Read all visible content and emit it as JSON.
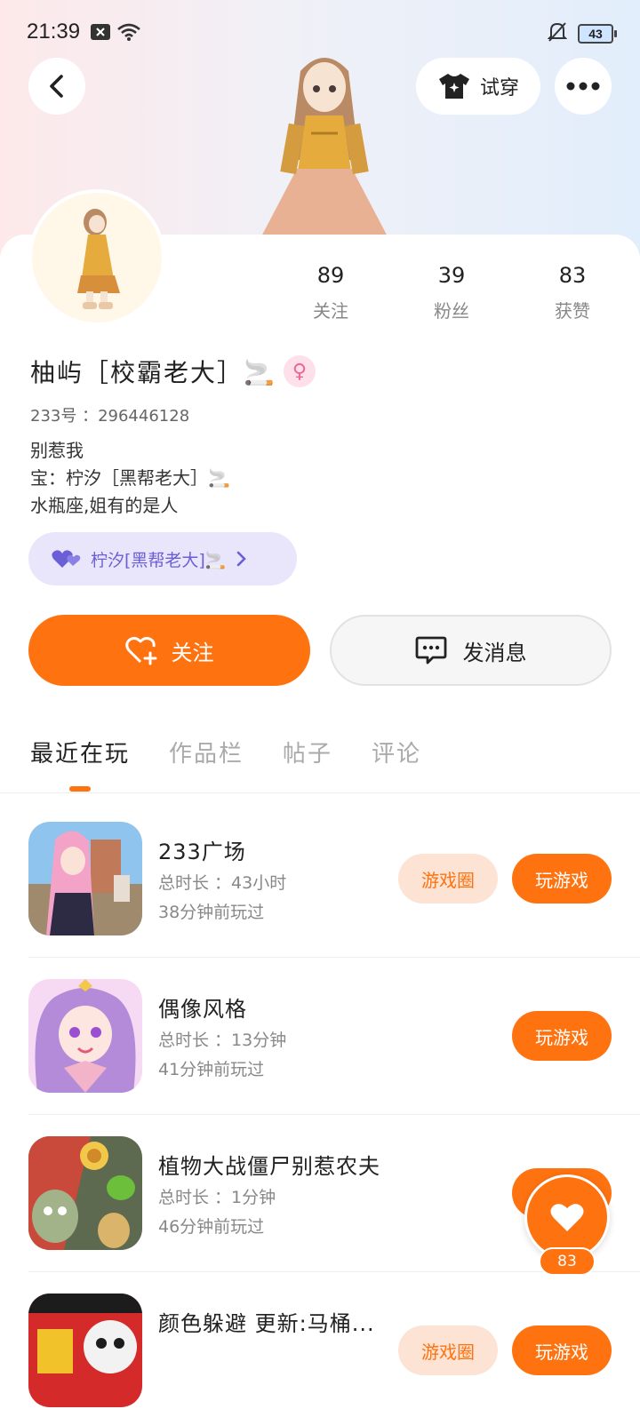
{
  "status_bar": {
    "time": "21:39",
    "battery": "43"
  },
  "header": {
    "try_on_label": "试穿"
  },
  "profile": {
    "stats": [
      {
        "num": "89",
        "label": "关注"
      },
      {
        "num": "39",
        "label": "粉丝"
      },
      {
        "num": "83",
        "label": "获赞"
      }
    ],
    "name": "柚屿［校霸老大］🚬",
    "uid": "233号 ：296446128",
    "bio_lines": [
      "别惹我",
      "宝：柠汐［黑帮老大］🚬",
      "水瓶座,姐有的是人"
    ],
    "relation_label": "柠汐[黑帮老大]🚬"
  },
  "actions": {
    "follow_label": "关注",
    "message_label": "发消息"
  },
  "tabs": [
    "最近在玩",
    "作品栏",
    "帖子",
    "评论"
  ],
  "games": [
    {
      "title": "233广场",
      "duration": "总时长 ：43小时",
      "last_played": "38分钟前玩过",
      "circle_label": "游戏圈",
      "play_label": "玩游戏"
    },
    {
      "title": "偶像风格",
      "duration": "总时长 ：13分钟",
      "last_played": "41分钟前玩过",
      "circle_label": "",
      "play_label": "玩游戏"
    },
    {
      "title": "植物大战僵尸别惹农夫",
      "duration": "总时长 ：1分钟",
      "last_played": "46分钟前玩过",
      "circle_label": "",
      "play_label": ""
    },
    {
      "title": "颜色躲避 更新:马桶...",
      "duration": "",
      "last_played": "",
      "circle_label": "游戏圈",
      "play_label": "玩游戏"
    }
  ],
  "like_float": {
    "count": "83"
  },
  "colors": {
    "accent": "#ff7210",
    "accent_light": "#fde3d3",
    "relation_bg": "#e9e6fb",
    "relation_text": "#6a5fd6"
  }
}
